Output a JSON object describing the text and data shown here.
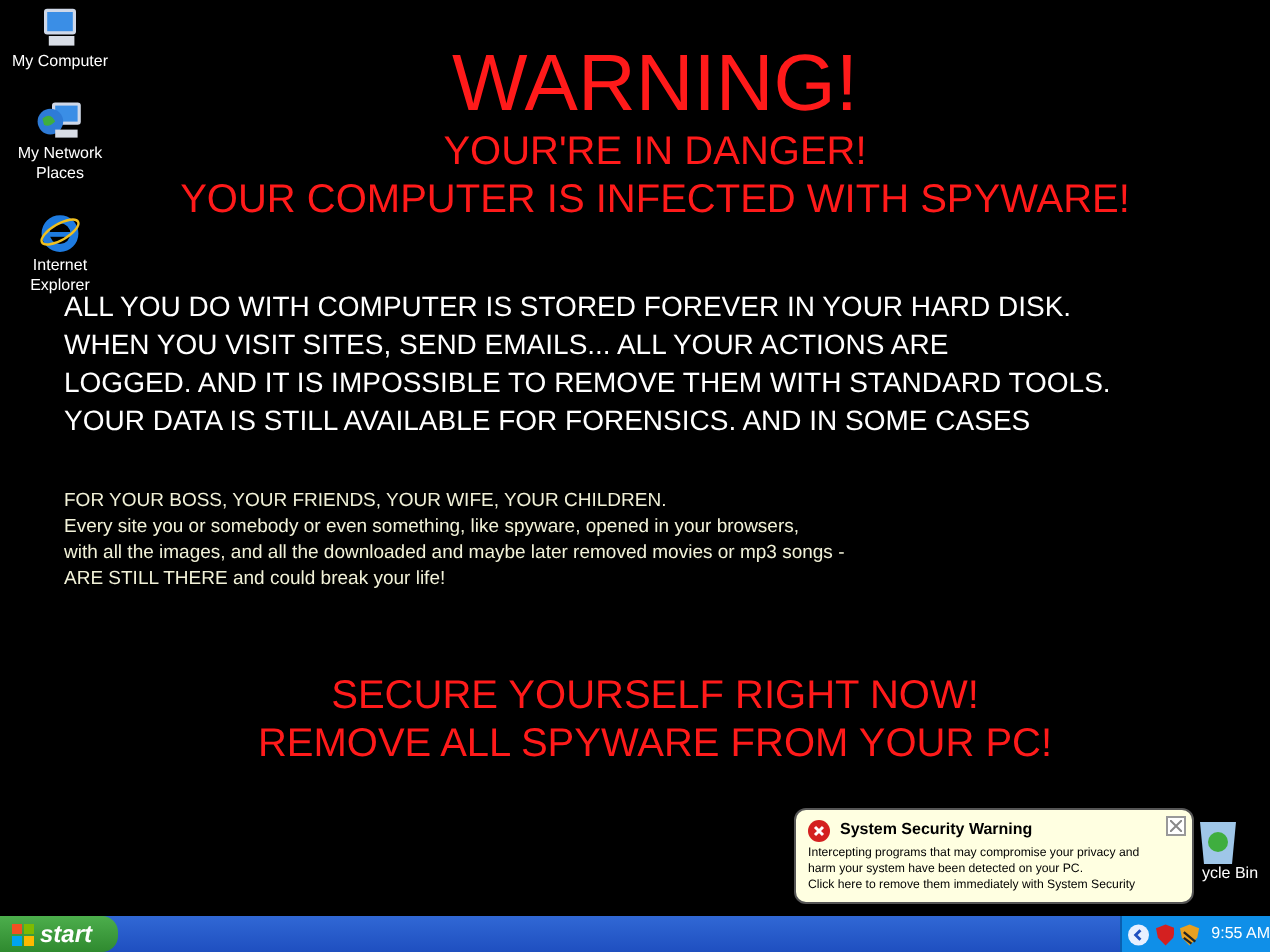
{
  "desktop_icons": [
    {
      "label": "My Computer",
      "kind": "computer"
    },
    {
      "label": "My Network Places",
      "kind": "network"
    },
    {
      "label": "Internet Explorer",
      "kind": "browser"
    }
  ],
  "wallpaper": {
    "title": "WARNING!",
    "subtitles": [
      "YOUR'RE IN DANGER!",
      "YOUR COMPUTER IS INFECTED WITH SPYWARE!"
    ],
    "body_lines": [
      "ALL YOU DO WITH COMPUTER IS STORED FOREVER IN YOUR HARD DISK.",
      "WHEN YOU VISIT SITES, SEND EMAILS... ALL YOUR ACTIONS ARE",
      "LOGGED. AND IT IS IMPOSSIBLE TO REMOVE THEM WITH STANDARD TOOLS.",
      "YOUR DATA IS STILL AVAILABLE FOR FORENSICS. AND IN SOME CASES"
    ],
    "small_lines": [
      "FOR YOUR BOSS, YOUR FRIENDS, YOUR WIFE, YOUR CHILDREN.",
      "Every site you or somebody or even something, like spyware, opened in your browsers,",
      "with all the images, and all the downloaded and maybe later removed movies or mp3 songs -",
      "ARE STILL THERE and could break your life!"
    ],
    "footer_lines": [
      "SECURE YOURSELF RIGHT NOW!",
      "REMOVE ALL SPYWARE FROM YOUR PC!"
    ]
  },
  "recycle_bin": {
    "label": "ycle Bin"
  },
  "balloon": {
    "title": "System Security Warning",
    "lines": [
      "Intercepting programs that may compromise your privacy and",
      "harm your system have been detected on your PC.",
      "Click here to remove them immediately with System Security"
    ]
  },
  "taskbar": {
    "start": "start",
    "clock": "9:55 AM"
  }
}
